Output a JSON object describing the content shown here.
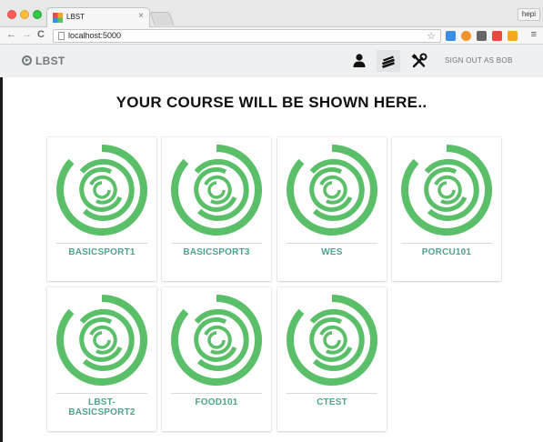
{
  "browser": {
    "tab_title": "LBST",
    "tab_close": "×",
    "profile_name": "hepi",
    "url": "localhost:5000",
    "back_glyph": "←",
    "forward_glyph": "→",
    "reload_glyph": "C",
    "star_glyph": "☆",
    "menu_glyph": "≡",
    "extension_colors": [
      "#3a8ee6",
      "#f6922d",
      "#666666",
      "#e8483d",
      "#f6a623"
    ]
  },
  "nav": {
    "brand": "LBST",
    "icons": [
      "user-icon",
      "courses-stack-icon",
      "tools-icon"
    ],
    "signout": "SIGN OUT AS BOB"
  },
  "main": {
    "headline": "YOUR COURSE WILL BE SHOWN HERE..",
    "courses": [
      {
        "name": "BASICSPORT1"
      },
      {
        "name": "BASICSPORT3"
      },
      {
        "name": "WES"
      },
      {
        "name": "PORCU101"
      },
      {
        "name": "LBST-\nBASICSPORT2"
      },
      {
        "name": "FOOD101"
      },
      {
        "name": "CTEST"
      }
    ]
  },
  "colors": {
    "accent": "#4ea48c",
    "logo_green": "#5bbf6a"
  }
}
